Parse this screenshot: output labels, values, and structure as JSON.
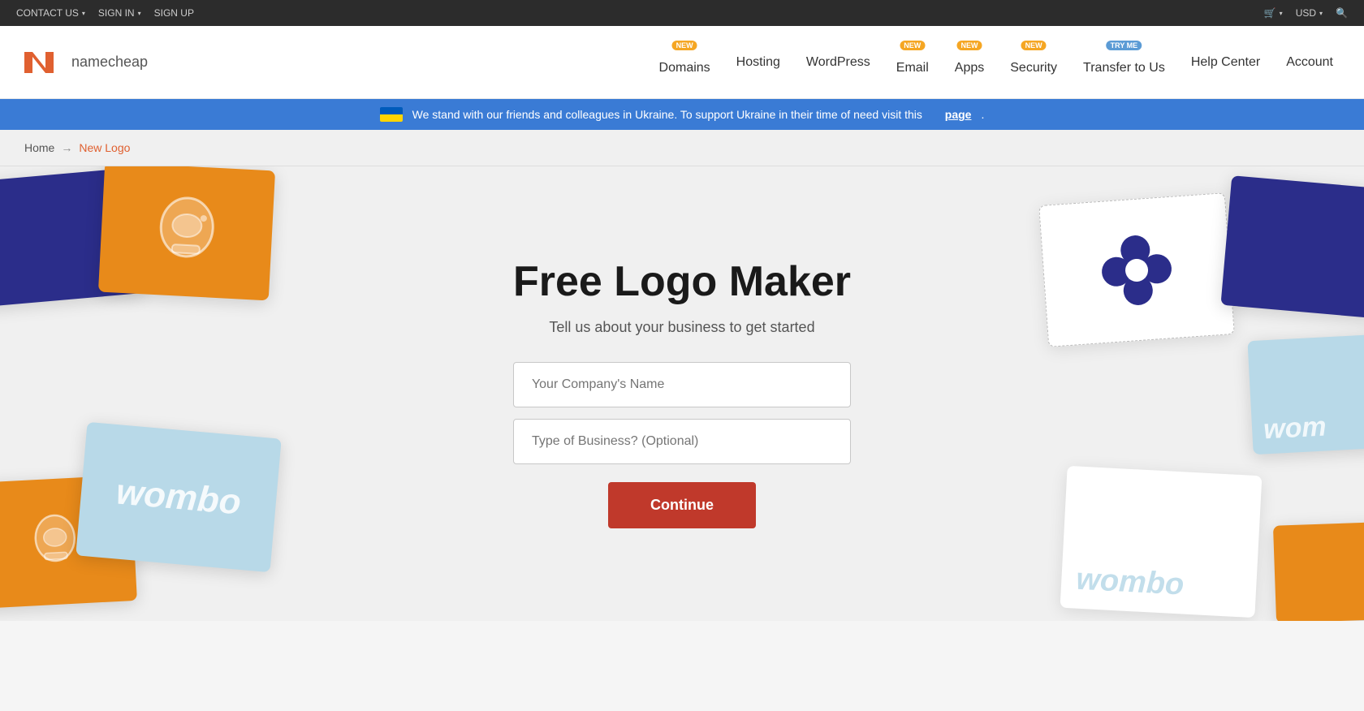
{
  "topbar": {
    "contact_us": "CONTACT US",
    "sign_in": "SIGN IN",
    "sign_up": "SIGN UP",
    "cart": "Cart",
    "currency": "USD",
    "search": "Search"
  },
  "nav": {
    "logo_text": "namecheap",
    "items": [
      {
        "label": "Domains",
        "badge": "NEW",
        "badge_type": "new"
      },
      {
        "label": "Hosting",
        "badge": null,
        "badge_type": null
      },
      {
        "label": "WordPress",
        "badge": null,
        "badge_type": null
      },
      {
        "label": "Email",
        "badge": "NEW",
        "badge_type": "new"
      },
      {
        "label": "Apps",
        "badge": "NEW",
        "badge_type": "new"
      },
      {
        "label": "Security",
        "badge": "NEW",
        "badge_type": "new"
      },
      {
        "label": "Transfer to Us",
        "badge": "TRY ME",
        "badge_type": "tryme"
      },
      {
        "label": "Help Center",
        "badge": null,
        "badge_type": null
      },
      {
        "label": "Account",
        "badge": null,
        "badge_type": null
      }
    ]
  },
  "ukraine_banner": {
    "text": "We stand with our friends and colleagues in Ukraine. To support Ukraine in their time of need visit this",
    "link_text": "page",
    "link_url": "#"
  },
  "breadcrumb": {
    "home": "Home",
    "arrow": "→",
    "current": "New Logo"
  },
  "hero": {
    "title": "Free Logo Maker",
    "subtitle": "Tell us about your business to get started",
    "company_name_placeholder": "Your Company's Name",
    "business_type_placeholder": "Type of Business? (Optional)",
    "continue_label": "Continue",
    "wombo_text": "wombo"
  },
  "colors": {
    "orange": "#e88a1a",
    "blue": "#2b2d8a",
    "light_blue": "#b8d9e8",
    "red": "#c0392b",
    "nav_blue": "#3a7bd5"
  }
}
